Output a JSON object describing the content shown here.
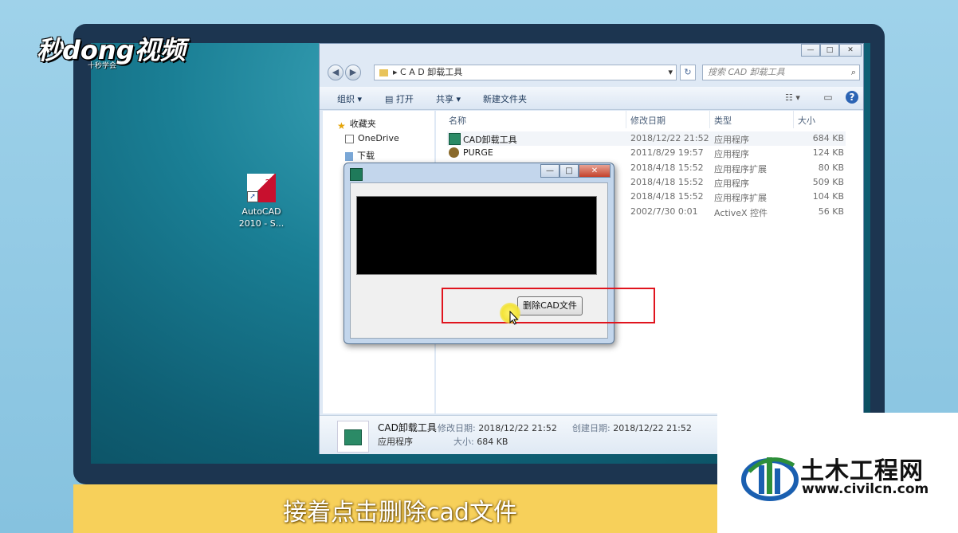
{
  "watermark": {
    "main": "秒dong视频",
    "sub": "十秒学会"
  },
  "desktop_icon": {
    "label_line1": "AutoCAD",
    "label_line2": "2010 - S...",
    "year_badge": "20\n10"
  },
  "explorer": {
    "address": {
      "separator": "▸",
      "path": "C A D 卸载工具",
      "dropdown": "▾",
      "refresh": "↻"
    },
    "search_placeholder": "搜索 CAD 卸载工具",
    "window_controls": {
      "minimize": "—",
      "maximize": "□",
      "close": "✕"
    },
    "toolbar": {
      "organize": "组织 ▾",
      "open": "打开",
      "share": "共享 ▾",
      "new_folder": "新建文件夹",
      "view": "☷ ▾",
      "preview": "▭",
      "help": "?"
    },
    "nav": {
      "favorites": "收藏夹",
      "onedrive": "OneDrive",
      "downloads": "下载"
    },
    "columns": {
      "name": "名称",
      "modified": "修改日期",
      "type": "类型",
      "size": "大小"
    },
    "files": [
      {
        "name": "CAD卸载工具",
        "date": "2018/12/22 21:52",
        "type": "应用程序",
        "size": "684 KB"
      },
      {
        "name": "PURGE",
        "date": "2011/8/29 19:57",
        "type": "应用程序",
        "size": "124 KB"
      },
      {
        "name": "",
        "date": "2018/4/18 15:52",
        "type": "应用程序扩展",
        "size": "80 KB"
      },
      {
        "name": "",
        "date": "2018/4/18 15:52",
        "type": "应用程序",
        "size": "509 KB"
      },
      {
        "name": "",
        "date": "2018/4/18 15:52",
        "type": "应用程序扩展",
        "size": "104 KB"
      },
      {
        "name": "",
        "date": "2002/7/30 0:01",
        "type": "ActiveX 控件",
        "size": "56 KB"
      }
    ],
    "details": {
      "name": "CAD卸载工具",
      "modified_label": "修改日期:",
      "modified": "2018/12/22 21:52",
      "created_label": "创建日期:",
      "created": "2018/12/22 21:52",
      "type": "应用程序",
      "size_label": "大小:",
      "size": "684 KB"
    }
  },
  "dialog": {
    "delete_button": "删除CAD文件",
    "controls": {
      "minimize": "—",
      "maximize": "□",
      "close": "✕"
    }
  },
  "caption": "接着点击删除cad文件",
  "brand": {
    "name": "土木工程网",
    "url": "www.civilcn.com"
  },
  "colors": {
    "highlight_rect": "#e0141e",
    "caption_bar": "#f7d05a"
  }
}
